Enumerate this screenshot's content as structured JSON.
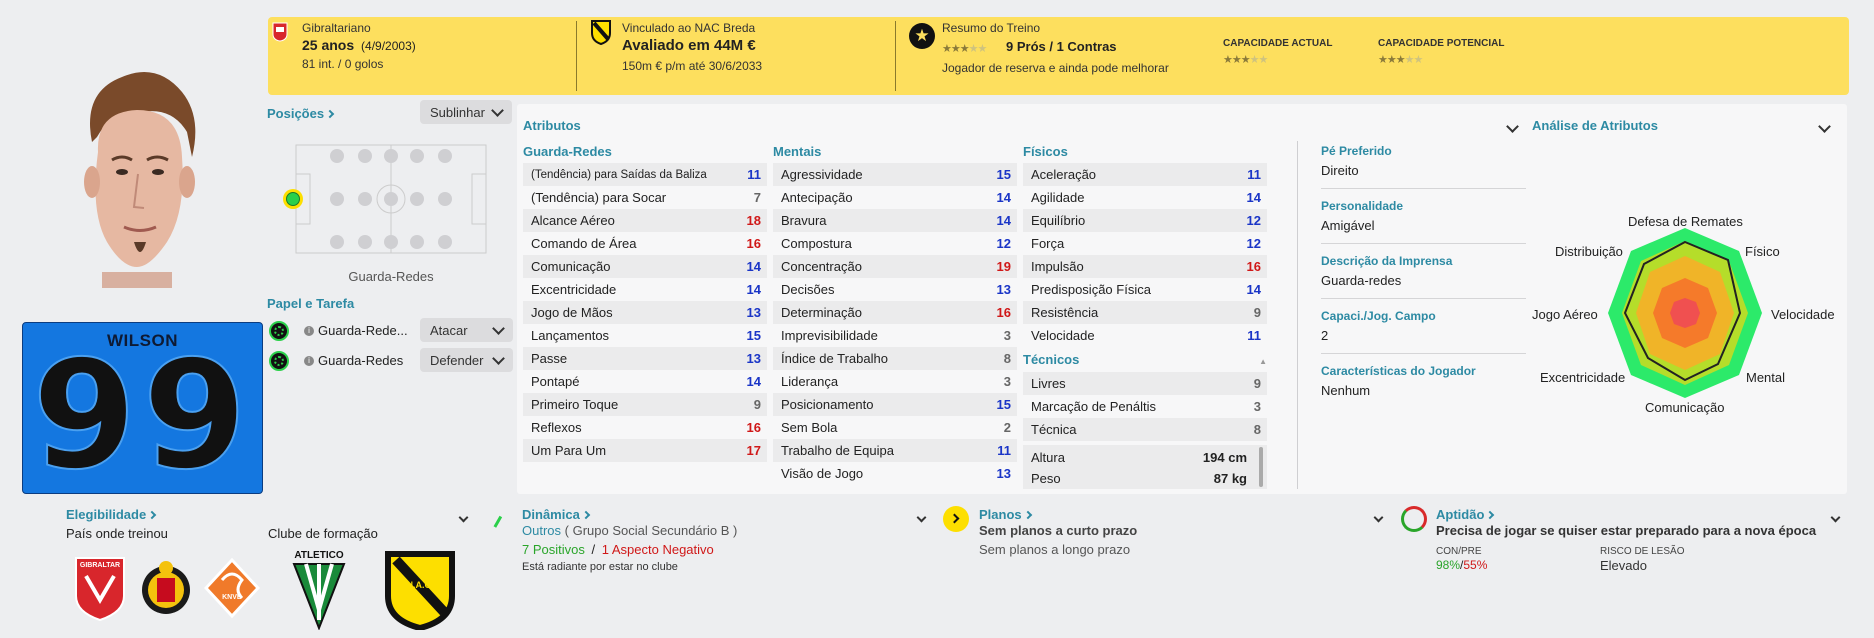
{
  "top": {
    "nationality": "Gibraltariano",
    "age": "25 anos",
    "dob": "(4/9/2003)",
    "caps": "81 int. / 0 golos",
    "club_link": "Vinculado ao NAC Breda",
    "value": "Avaliado em 44M €",
    "wage": "150m € p/m até 30/6/2033",
    "training_title": "Resumo do Treino",
    "pros_cons": "9 Prós / 1 Contras",
    "training_note": "Jogador de reserva e ainda pode melhorar",
    "ca_label": "CAPACIDADE ACTUAL",
    "pa_label": "CAPACIDADE POTENCIAL",
    "training_stars": 3,
    "ca_stars": 3,
    "pa_stars": 3
  },
  "player": {
    "name": "WILSON",
    "number": "99",
    "shirt_color": "#1477e0"
  },
  "positions": {
    "title": "Posições",
    "highlight_btn": "Sublinhar",
    "pos_label": "Guarda-Redes",
    "role_title": "Papel e Tarefa",
    "roles": [
      {
        "name": "Guarda-Rede...",
        "duty": "Atacar"
      },
      {
        "name": "Guarda-Redes",
        "duty": "Defender"
      }
    ]
  },
  "attributes": {
    "title": "Atributos",
    "goalkeeping": {
      "title": "Guarda-Redes",
      "items": [
        {
          "name": "(Tendência) para Saídas da Baliza",
          "value": "11",
          "c": "blue"
        },
        {
          "name": "(Tendência) para Socar",
          "value": "7",
          "c": "gray"
        },
        {
          "name": "Alcance Aéreo",
          "value": "18",
          "c": "red"
        },
        {
          "name": "Comando de Área",
          "value": "16",
          "c": "red"
        },
        {
          "name": "Comunicação",
          "value": "14",
          "c": "blue"
        },
        {
          "name": "Excentricidade",
          "value": "14",
          "c": "blue"
        },
        {
          "name": "Jogo de Mãos",
          "value": "13",
          "c": "blue"
        },
        {
          "name": "Lançamentos",
          "value": "15",
          "c": "blue"
        },
        {
          "name": "Passe",
          "value": "13",
          "c": "blue"
        },
        {
          "name": "Pontapé",
          "value": "14",
          "c": "blue"
        },
        {
          "name": "Primeiro Toque",
          "value": "9",
          "c": "gray"
        },
        {
          "name": "Reflexos",
          "value": "16",
          "c": "red"
        },
        {
          "name": "Um Para Um",
          "value": "17",
          "c": "red"
        }
      ]
    },
    "mental": {
      "title": "Mentais",
      "items": [
        {
          "name": "Agressividade",
          "value": "15",
          "c": "blue"
        },
        {
          "name": "Antecipação",
          "value": "14",
          "c": "blue"
        },
        {
          "name": "Bravura",
          "value": "14",
          "c": "blue"
        },
        {
          "name": "Compostura",
          "value": "12",
          "c": "blue"
        },
        {
          "name": "Concentração",
          "value": "19",
          "c": "red"
        },
        {
          "name": "Decisões",
          "value": "13",
          "c": "blue"
        },
        {
          "name": "Determinação",
          "value": "16",
          "c": "red"
        },
        {
          "name": "Imprevisibilidade",
          "value": "3",
          "c": "gray"
        },
        {
          "name": "Índice de Trabalho",
          "value": "8",
          "c": "gray"
        },
        {
          "name": "Liderança",
          "value": "3",
          "c": "gray"
        },
        {
          "name": "Posicionamento",
          "value": "15",
          "c": "blue"
        },
        {
          "name": "Sem Bola",
          "value": "2",
          "c": "gray"
        },
        {
          "name": "Trabalho de Equipa",
          "value": "11",
          "c": "blue"
        },
        {
          "name": "Visão de Jogo",
          "value": "13",
          "c": "blue"
        }
      ]
    },
    "physical": {
      "title": "Físicos",
      "items": [
        {
          "name": "Aceleração",
          "value": "11",
          "c": "blue"
        },
        {
          "name": "Agilidade",
          "value": "14",
          "c": "blue"
        },
        {
          "name": "Equilíbrio",
          "value": "12",
          "c": "blue"
        },
        {
          "name": "Força",
          "value": "12",
          "c": "blue"
        },
        {
          "name": "Impulsão",
          "value": "16",
          "c": "red"
        },
        {
          "name": "Predisposição Física",
          "value": "14",
          "c": "blue"
        },
        {
          "name": "Resistência",
          "value": "9",
          "c": "gray"
        },
        {
          "name": "Velocidade",
          "value": "11",
          "c": "blue"
        }
      ]
    },
    "technical": {
      "title": "Técnicos",
      "items": [
        {
          "name": "Livres",
          "value": "9",
          "c": "gray"
        },
        {
          "name": "Marcação de Penáltis",
          "value": "3",
          "c": "gray"
        },
        {
          "name": "Técnica",
          "value": "8",
          "c": "gray"
        }
      ]
    },
    "height_label": "Altura",
    "height": "194 cm",
    "weight_label": "Peso",
    "weight": "87 kg"
  },
  "info": {
    "foot_label": "Pé Preferido",
    "foot": "Direito",
    "personality_label": "Personalidade",
    "personality": "Amigável",
    "media_label": "Descrição da Imprensa",
    "media": "Guarda-redes",
    "outfield_label": "Capaci./Jog. Campo",
    "outfield": "2",
    "traits_label": "Características do Jogador",
    "traits": "Nenhum"
  },
  "analysis": {
    "title": "Análise de Atributos",
    "labels": [
      "Defesa de Remates",
      "Físico",
      "Velocidade",
      "Mental",
      "Comunicação",
      "Excentricidade",
      "Jogo Aéreo",
      "Distribuição"
    ]
  },
  "bottom": {
    "eligibility": "Elegibilidade",
    "trained_in": "País onde treinou",
    "youth_club": "Clube de formação",
    "badge_gib": "GIBRALTAR",
    "badge_atl": "ATLETICO",
    "badge_knvb": "KNVB",
    "badge_nac": "N.A.C.",
    "dynamics": "Dinâmica",
    "social_group": "Outros",
    "social_group_detail": "( Grupo Social Secundário B )",
    "positives": "7 Positivos",
    "negatives": "1 Aspecto Negativo",
    "slash": "/",
    "mood": "Está radiante por estar no clube",
    "plans": "Planos",
    "plan_short": "Sem planos a curto prazo",
    "plan_long": "Sem planos a longo prazo",
    "fitness": "Aptidão",
    "fitness_msg": "Precisa de jogar se quiser estar preparado para a nova época",
    "conpre_label": "CON/PRE",
    "con": "98%",
    "pre": "55%",
    "injury_label": "RISCO DE LESÃO",
    "injury": "Elevado"
  }
}
